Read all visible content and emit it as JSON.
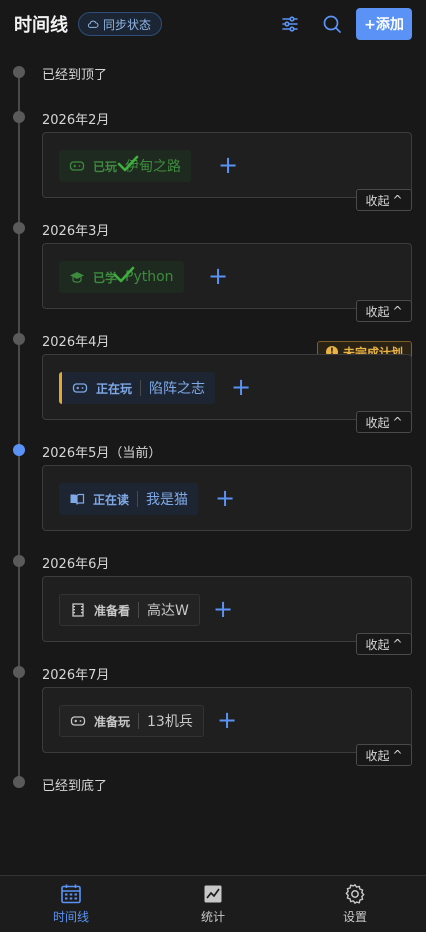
{
  "header": {
    "title": "时间线",
    "sync_label": "同步状态",
    "add_label": "+添加",
    "icons": [
      "filter-icon",
      "search-icon"
    ]
  },
  "timeline": {
    "top_label": "已经到顶了",
    "bottom_label": "已经到底了",
    "collapse_label": "收起",
    "months": [
      {
        "label": "2026年2月",
        "status": "已玩",
        "name": "伊甸之路",
        "state": "done",
        "icon": "gamepad-icon",
        "collapsible": true
      },
      {
        "label": "2026年3月",
        "status": "已学",
        "name": "Python",
        "state": "done",
        "icon": "graduation-cap-icon",
        "collapsible": true
      },
      {
        "label": "2026年4月",
        "status": "正在玩",
        "name": "陷阵之志",
        "state": "in-progress",
        "icon": "gamepad-icon",
        "collapsible": true,
        "badge": "未完成计划"
      },
      {
        "label": "2026年5月（当前）",
        "status": "正在读",
        "name": "我是猫",
        "state": "in-progress",
        "icon": "book-icon",
        "collapsible": false,
        "current": true
      },
      {
        "label": "2026年6月",
        "status": "准备看",
        "name": "高达W",
        "state": "planned",
        "icon": "film-icon",
        "collapsible": true
      },
      {
        "label": "2026年7月",
        "status": "准备玩",
        "name": "13机兵",
        "state": "planned",
        "icon": "gamepad-icon",
        "collapsible": true
      }
    ]
  },
  "nav": {
    "items": [
      {
        "label": "时间线",
        "icon": "calendar-icon",
        "active": true
      },
      {
        "label": "统计",
        "icon": "chart-icon",
        "active": false
      },
      {
        "label": "设置",
        "icon": "gear-icon",
        "active": false
      }
    ]
  },
  "colors": {
    "accent": "#5a93f5",
    "done": "#3e8a3e",
    "warning": "#e9b345",
    "background": "#181818"
  }
}
